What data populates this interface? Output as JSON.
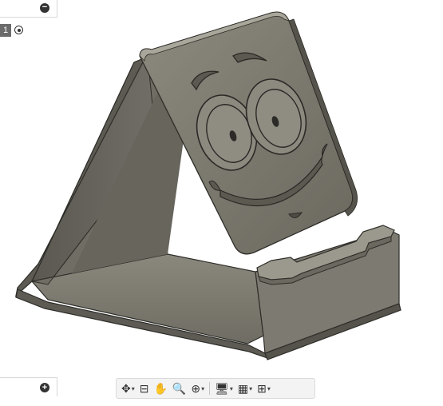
{
  "browser": {
    "panel_top": {
      "collapse_symbol": "−"
    },
    "row": {
      "index": "1",
      "icon": "radio-target-icon"
    },
    "panel_bottom": {
      "expand_symbol": "+"
    }
  },
  "toolbar": {
    "buttons": [
      {
        "icon": "orbit-icon",
        "glyph": "✥",
        "has_dropdown": true
      },
      {
        "icon": "look-at-icon",
        "glyph": "⊟",
        "has_dropdown": false
      },
      {
        "icon": "pan-hand-icon",
        "glyph": "✋",
        "has_dropdown": false
      },
      {
        "icon": "zoom-icon",
        "glyph": "🔍",
        "has_dropdown": false
      },
      {
        "icon": "zoom-window-icon",
        "glyph": "⊕",
        "has_dropdown": true
      },
      {
        "icon": "display-settings-icon",
        "glyph": "🖥",
        "has_dropdown": true
      },
      {
        "icon": "grid-icon",
        "glyph": "▦",
        "has_dropdown": true
      },
      {
        "icon": "viewports-icon",
        "glyph": "⊞",
        "has_dropdown": true
      }
    ]
  },
  "colors": {
    "model_body": "#7a786d",
    "model_light": "#a7a599",
    "model_dark": "#4a4943",
    "background": "#ffffff"
  }
}
